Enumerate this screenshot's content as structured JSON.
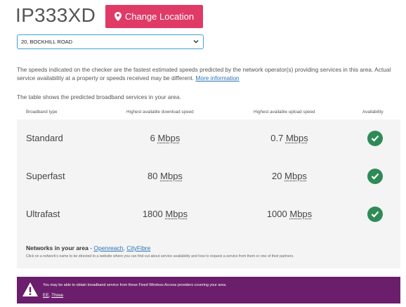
{
  "header": {
    "postcode": "IP333XD",
    "change_location_label": "Change Location"
  },
  "address_select": {
    "selected": "20, BOCKHILL ROAD"
  },
  "intro": {
    "text": "The speeds indicated on the checker are the fastest estimated speeds predicted by the network operator(s) providing services in this area. Actual service availability at a property or speeds received may be different.",
    "link_label": "More information",
    "table_intro": "The table shows the predicted broadband services in your area."
  },
  "table": {
    "headers": {
      "type": "Broadband type",
      "download": "Highest available download speed",
      "upload": "Highest available upload speed",
      "availability": "Availability"
    },
    "rows": [
      {
        "type": "Standard",
        "download": "6",
        "upload": "0.7",
        "unit": "Mbps",
        "available": true
      },
      {
        "type": "Superfast",
        "download": "80",
        "upload": "20",
        "unit": "Mbps",
        "available": true
      },
      {
        "type": "Ultrafast",
        "download": "1800",
        "upload": "1000",
        "unit": "Mbps",
        "available": true
      }
    ]
  },
  "networks": {
    "label": "Networks in your area",
    "separator": "-",
    "items": [
      "Openreach",
      "CityFibre"
    ],
    "note": "Click on a network's name to be directed to a website where you can find out about service availability and how to request a service from them or one of their partners."
  },
  "fwa_banner": {
    "message": "You may be able to obtain broadband service from these Fixed Wireless Access providers covering your area.",
    "providers": [
      "EE",
      "Three"
    ]
  },
  "colors": {
    "accent": "#e03a66",
    "link": "#2a73b8",
    "available": "#2e8b57",
    "banner": "#6b1e6b"
  },
  "icons": {
    "change_location": "map-pin-icon",
    "select": "chevron-down-icon",
    "availability": "check-circle-icon",
    "banner": "warning-icon"
  }
}
